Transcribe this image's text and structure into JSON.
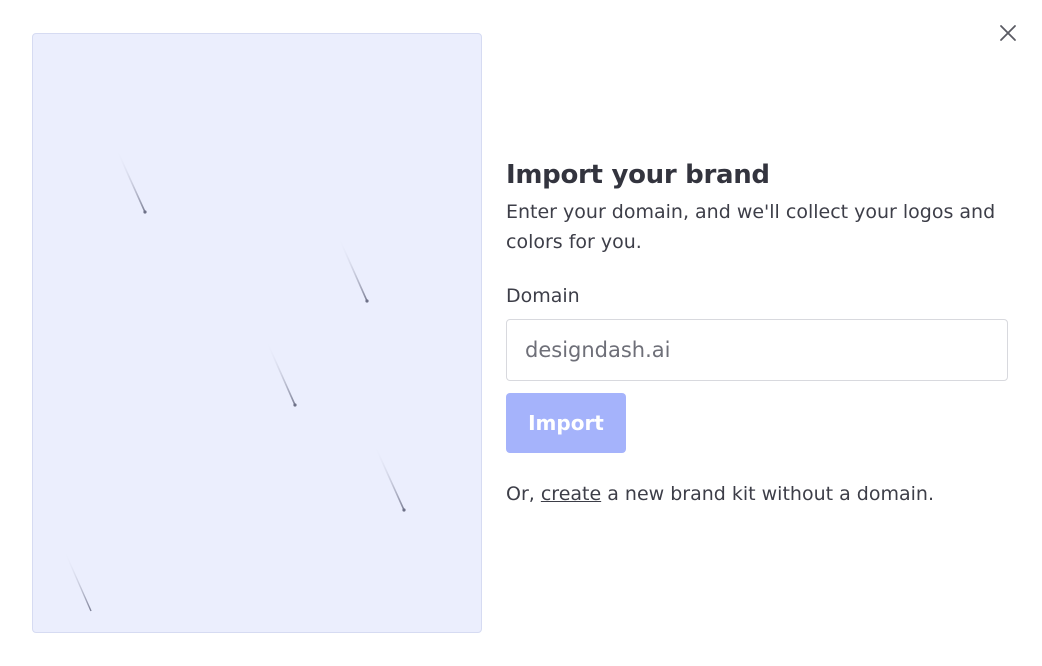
{
  "dialog": {
    "close_icon": "close-icon",
    "title": "Import your brand",
    "subtitle": "Enter your domain, and we'll collect your logos and colors for you.",
    "domain_label": "Domain",
    "domain_placeholder": "designdash.ai",
    "domain_value": "",
    "import_label": "Import",
    "alt_prefix": "Or,",
    "alt_link": "create",
    "alt_suffix": "a new brand kit without a domain."
  },
  "colors": {
    "illustration_bg": "#ebeefd",
    "import_button_disabled": "#a5b3fb",
    "text": "#3a3b45"
  }
}
